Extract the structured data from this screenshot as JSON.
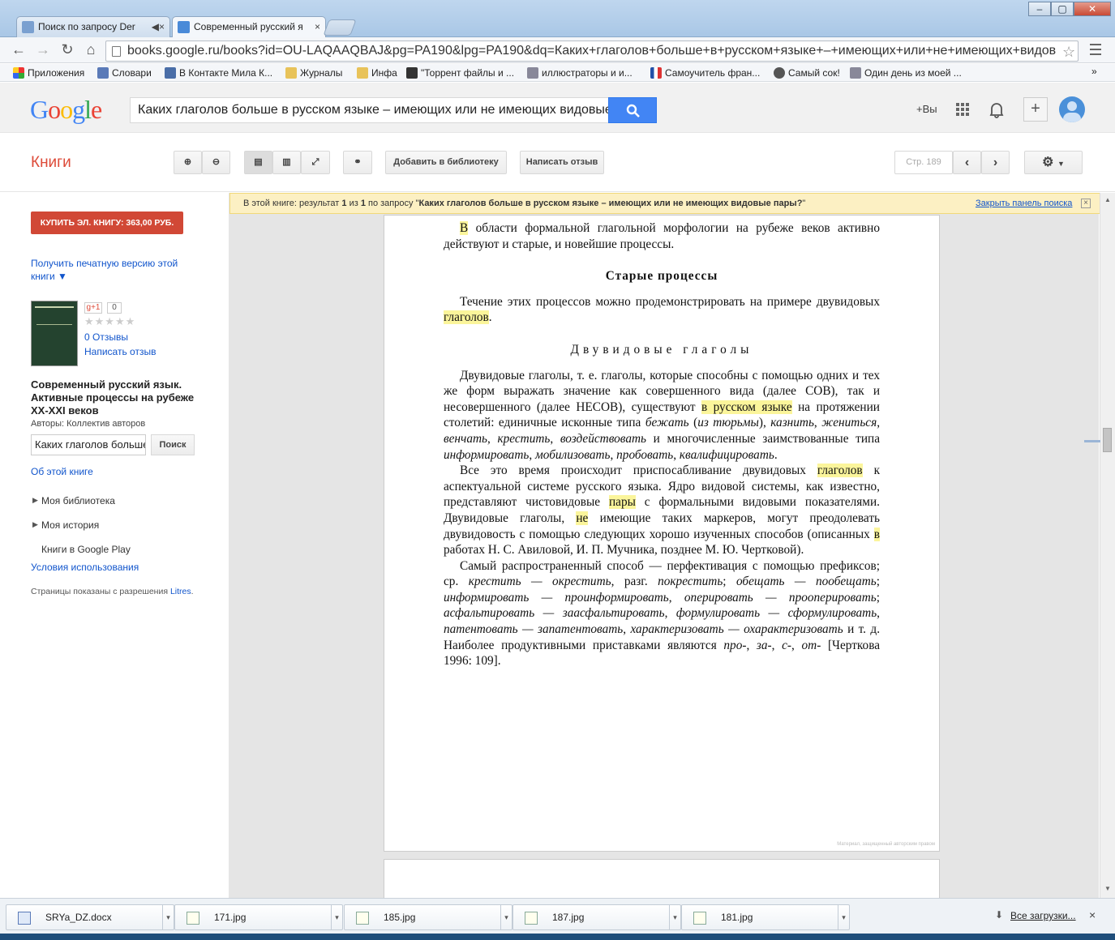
{
  "window": {
    "tabs": [
      {
        "label": "Поиск по запросу Der"
      },
      {
        "label": "Современный русский я"
      }
    ],
    "url": "books.google.ru/books?id=OU-LAQAAQBAJ&pg=PA190&lpg=PA190&dq=Каких+глаголов+больше+в+русском+языке+–+имеющих+или+не+имеющих+видов"
  },
  "bookmarks": [
    {
      "label": "Приложения",
      "color": "#e33"
    },
    {
      "label": "Словари",
      "color": "#56a"
    },
    {
      "label": "В Контакте Мила К...",
      "color": "#4a6ea8"
    },
    {
      "label": "Журналы",
      "color": "#e8c35a"
    },
    {
      "label": "Инфа",
      "color": "#e8c35a"
    },
    {
      "label": "\"Торрент файлы и ...",
      "color": "#333"
    },
    {
      "label": "иллюстраторы и и...",
      "color": "#668"
    },
    {
      "label": "Самоучитель фран...",
      "color": "#d33"
    },
    {
      "label": "Самый сок!",
      "color": "#444"
    },
    {
      "label": "Один день из моей ...",
      "color": "#668"
    }
  ],
  "google": {
    "logo": "Google",
    "query": "Каких глаголов больше в русском языке – имеющих или не имеющих видовые п",
    "plus_you": "+Вы"
  },
  "books_bar": {
    "section": "Книги",
    "add_library": "Добавить в библиотеку",
    "write_review": "Написать отзыв",
    "page_label": "Стр. 189"
  },
  "left": {
    "buy": "КУПИТЬ ЭЛ. КНИГУ: 363,00 РУБ.",
    "print_version": "Получить печатную версию этой книги ▼",
    "gplus": "g+1",
    "gplus_count": "0",
    "reviews": "0 Отзывы",
    "write_review": "Написать отзыв",
    "title": "Современный русский язык. Активные процессы на рубеже XX-XXI веков",
    "authors": "Авторы: Коллектив авторов",
    "search_value": "Каких глаголов больше",
    "search_btn": "Поиск",
    "about": "Об этой книге",
    "my_library": "Моя библиотека",
    "my_history": "Моя история",
    "play": "Книги в Google Play",
    "terms": "Условия использования",
    "permission_prefix": "Страницы показаны с разрешения ",
    "permission_link": "Litres",
    "permission_suffix": "."
  },
  "notice": {
    "p1": "В этой книге: результат ",
    "n1": "1",
    "p2": " из ",
    "n2": "1",
    "p3": " по запросу \"",
    "query": "Каких глаголов больше в русском языке – имеющих или не имеющих видовые пары?",
    "p4": "\"",
    "close": "Закрыть панель поиска"
  },
  "page": {
    "heading1": "Старые процессы",
    "heading2": "Двувидовые глаголы",
    "watermark": "Материал, защищенный авторским правом"
  },
  "downloads": {
    "items": [
      "SRYa_DZ.docx",
      "171.jpg",
      "185.jpg",
      "187.jpg",
      "181.jpg"
    ],
    "all": "Все загрузки..."
  }
}
